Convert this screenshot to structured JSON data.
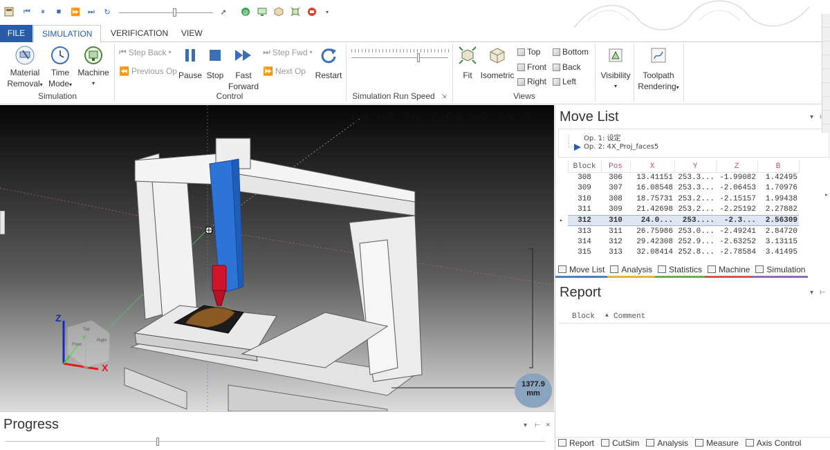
{
  "quick_access": {
    "icons": [
      "app-icon",
      "skip-back-icon",
      "pause-icon",
      "stop-icon",
      "fast-forward-icon",
      "skip-next-icon",
      "restart-icon",
      "cursor-icon",
      "globe-icon",
      "monitor-icon",
      "cube-icon",
      "fit-icon",
      "record-icon",
      "dropdown-icon"
    ]
  },
  "tabs": {
    "file": "FILE",
    "simulation": "SIMULATION",
    "verification": "VERIFICATION",
    "view": "VIEW"
  },
  "ribbon": {
    "simulation_group": {
      "label": "Simulation",
      "material_removal_1": "Material",
      "material_removal_2": "Removal",
      "time_mode_1": "Time",
      "time_mode_2": "Mode",
      "machine": "Machine"
    },
    "control_group": {
      "label": "Control",
      "step_back": "Step Back",
      "previous_op": "Previous Op",
      "pause": "Pause",
      "stop": "Stop",
      "fast_forward_1": "Fast",
      "fast_forward_2": "Forward",
      "step_fwd": "Step Fwd",
      "next_op": "Next Op",
      "restart": "Restart"
    },
    "speed_group": {
      "label": "Simulation Run Speed",
      "speed_fraction": 0.68
    },
    "views_group": {
      "label": "Views",
      "fit": "Fit",
      "isometric": "Isometric",
      "top": "Top",
      "front": "Front",
      "right": "Right",
      "bottom": "Bottom",
      "back": "Back",
      "left": "Left"
    },
    "visibility": "Visibility",
    "toolpath_rendering_1": "Toolpath",
    "toolpath_rendering_2": "Rendering"
  },
  "viewport": {
    "clock": "00:00:09.7/00:00:35.5",
    "dimension_value": "1377.9",
    "dimension_unit": "mm",
    "axis_z": "Z",
    "axis_x": "X",
    "axis_y": "Y",
    "cube_front": "Front",
    "cube_right": "Right",
    "cube_top": "Top"
  },
  "move_list": {
    "title": "Move List",
    "ops": [
      "Op. 1: 设定",
      "Op. 2: 4X_Proj_faces5"
    ],
    "columns": [
      "Block",
      "Pos",
      "X",
      "Y",
      "Z",
      "B"
    ],
    "rows": [
      [
        "308",
        "306",
        "13.41151",
        "253.3...",
        "-1.99082",
        "1.42495"
      ],
      [
        "309",
        "307",
        "16.08548",
        "253.3...",
        "-2.06453",
        "1.70976"
      ],
      [
        "310",
        "308",
        "18.75731",
        "253.2...",
        "-2.15157",
        "1.99438"
      ],
      [
        "311",
        "309",
        "21.42698",
        "253.2...",
        "-2.25192",
        "2.27882"
      ],
      [
        "312",
        "310",
        "24.0...",
        "253....",
        "-2.3...",
        "2.56309"
      ],
      [
        "313",
        "311",
        "26.75986",
        "253.0...",
        "-2.49241",
        "2.84720"
      ],
      [
        "314",
        "312",
        "29.42308",
        "252.9...",
        "-2.63252",
        "3.13115"
      ],
      [
        "315",
        "313",
        "32.08414",
        "252.8...",
        "-2.78584",
        "3.41495"
      ]
    ],
    "selected_row": 4,
    "tabs": [
      "Move List",
      "Analysis",
      "Statistics",
      "Machine",
      "Simulation"
    ],
    "tab_colors": [
      "#4a7fc1",
      "#e5b53a",
      "#6aaf4a",
      "#d9534f",
      "#8e6bbf"
    ]
  },
  "report": {
    "title": "Report",
    "columns": [
      "Block",
      "Comment"
    ],
    "tabs": [
      "Report",
      "CutSim",
      "Analysis",
      "Measure",
      "Axis Control"
    ]
  },
  "progress": {
    "title": "Progress",
    "value_fraction": 0.28
  }
}
